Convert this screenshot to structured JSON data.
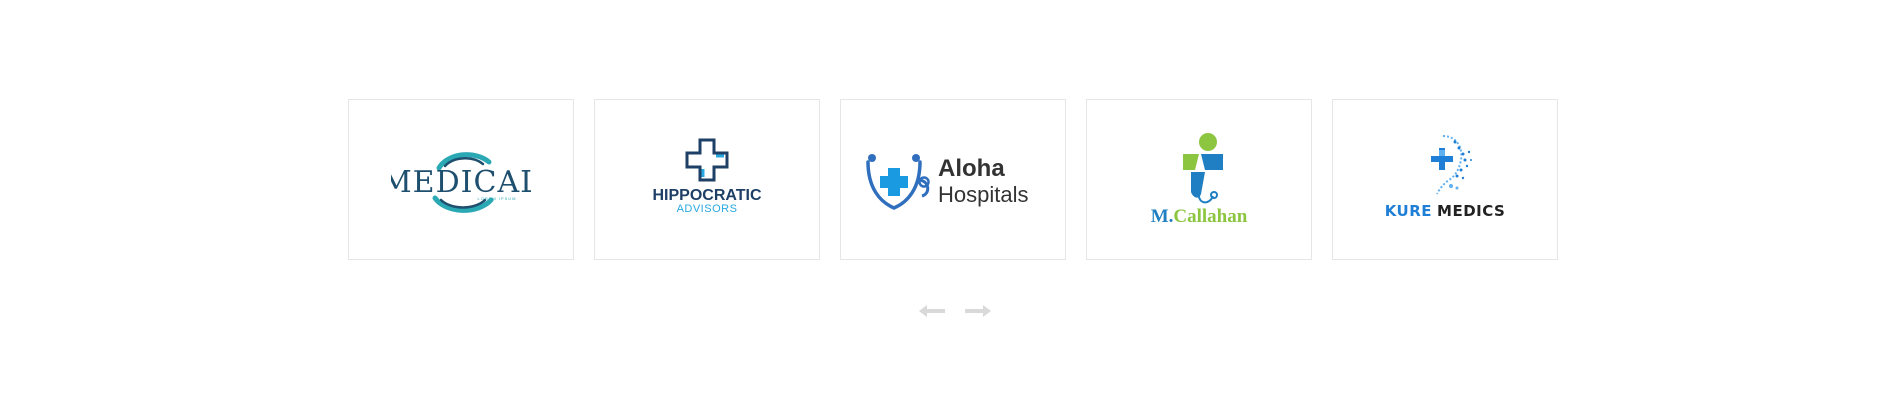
{
  "logos": [
    {
      "name": "MEDICAL",
      "sub": "LOREM IPSUM",
      "colors": {
        "primary": "#1e4f6e",
        "accent": "#2aa9b5"
      }
    },
    {
      "name": "HIPPOCRATIC",
      "sub": "ADVISORS",
      "colors": {
        "primary": "#1e3f66",
        "accent": "#29a8e0"
      }
    },
    {
      "name": "Aloha",
      "sub": "Hospitals",
      "colors": {
        "primary": "#2f6fbe",
        "accent": "#1a9ae0",
        "text": "#333333"
      }
    },
    {
      "name_prefix": "M.",
      "name_rest": "Callahan",
      "colors": {
        "primary": "#1f7fc2",
        "accent": "#8cc540"
      }
    },
    {
      "name_prefix": "KURE",
      "name_rest": "MEDICS",
      "colors": {
        "primary": "#1f7fd6",
        "text": "#222222"
      }
    }
  ],
  "nav": {
    "prev_icon": "arrow-left-icon",
    "next_icon": "arrow-right-icon",
    "color": "#d9d9d9"
  }
}
